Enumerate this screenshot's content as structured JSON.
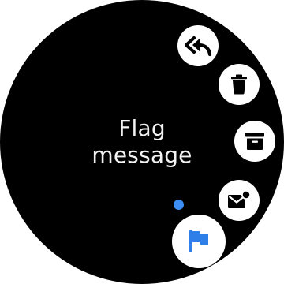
{
  "screen": {
    "label_line1": "Flag",
    "label_line2": "message"
  },
  "actions": [
    {
      "id": "reply-all",
      "icon": "reply-all-icon",
      "state": "default"
    },
    {
      "id": "delete",
      "icon": "trash-icon",
      "state": "default"
    },
    {
      "id": "archive",
      "icon": "archive-icon",
      "state": "default"
    },
    {
      "id": "mark-unread",
      "icon": "mail-unread-icon",
      "state": "default"
    },
    {
      "id": "flag",
      "icon": "flag-icon",
      "state": "selected"
    }
  ],
  "colors": {
    "background": "#000000",
    "button": "#ffffff",
    "icon": "#000000",
    "accent": "#2f7fe8",
    "indicator": "#3d8ff5",
    "text": "#f2f2f2"
  }
}
